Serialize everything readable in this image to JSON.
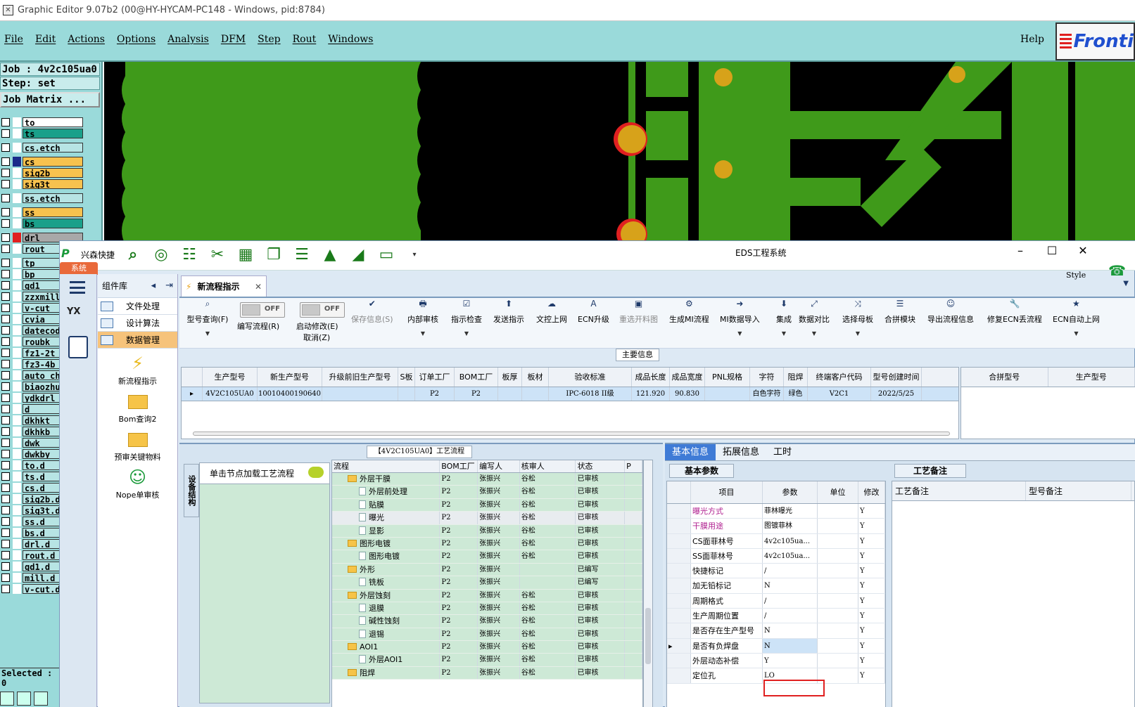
{
  "ge": {
    "title": "Graphic Editor 9.07b2 (00@HY-HYCAM-PC148 - Windows, pid:8784)",
    "menu": [
      "File",
      "Edit",
      "Actions",
      "Options",
      "Analysis",
      "DFM",
      "Step",
      "Rout",
      "Windows"
    ],
    "help": "Help",
    "logo": "Fronti",
    "job": "Job : 4v2c105ua0",
    "step": "Step: set",
    "job_matrix": "Job Matrix ...",
    "selected": "Selected : 0",
    "layers": [
      {
        "name": "to",
        "color": "#ffffff"
      },
      {
        "name": "ts",
        "color": "#1aa08a"
      },
      {
        "name": "cs.etch",
        "color": "#b7e4e4"
      },
      {
        "name": "cs",
        "color": "#f7c24e"
      },
      {
        "name": "sig2b",
        "color": "#f7c24e"
      },
      {
        "name": "sig3t",
        "color": "#f7c24e"
      },
      {
        "name": "ss.etch",
        "color": "#b7e4e4"
      },
      {
        "name": "ss",
        "color": "#f7c24e"
      },
      {
        "name": "bs",
        "color": "#1aa08a"
      },
      {
        "name": "drl",
        "color": "#a8a8a8"
      },
      {
        "name": "rout",
        "color": "#b7e4e4"
      },
      {
        "name": "tp",
        "color": "#b7e4e4"
      },
      {
        "name": "bp",
        "color": "#b7e4e4"
      },
      {
        "name": "gd1",
        "color": "#b7e4e4"
      },
      {
        "name": "zzxmill",
        "color": "#b7e4e4"
      },
      {
        "name": "v-cut",
        "color": "#b7e4e4"
      },
      {
        "name": "cvia",
        "color": "#b7e4e4"
      },
      {
        "name": "datecod",
        "color": "#b7e4e4"
      },
      {
        "name": "roubk",
        "color": "#b7e4e4"
      },
      {
        "name": "fz1-2t",
        "color": "#b7e4e4"
      },
      {
        "name": "fz3-4b",
        "color": "#b7e4e4"
      },
      {
        "name": "auto_ch",
        "color": "#b7e4e4"
      },
      {
        "name": "biaozhu",
        "color": "#b7e4e4"
      },
      {
        "name": "ydkdrl",
        "color": "#b7e4e4"
      },
      {
        "name": "d",
        "color": "#b7e4e4"
      },
      {
        "name": "dkhkt",
        "color": "#b7e4e4"
      },
      {
        "name": "dkhkb",
        "color": "#b7e4e4"
      },
      {
        "name": "dwk",
        "color": "#b7e4e4"
      },
      {
        "name": "dwkby",
        "color": "#b7e4e4"
      },
      {
        "name": "to.d",
        "color": "#b7e4e4"
      },
      {
        "name": "ts.d",
        "color": "#b7e4e4"
      },
      {
        "name": "cs.d",
        "color": "#b7e4e4"
      },
      {
        "name": "sig2b.d",
        "color": "#b7e4e4"
      },
      {
        "name": "sig3t.d",
        "color": "#b7e4e4"
      },
      {
        "name": "ss.d",
        "color": "#b7e4e4"
      },
      {
        "name": "bs.d",
        "color": "#b7e4e4"
      },
      {
        "name": "drl.d",
        "color": "#b7e4e4"
      },
      {
        "name": "rout.d",
        "color": "#b7e4e4"
      },
      {
        "name": "gd1.d",
        "color": "#b7e4e4"
      },
      {
        "name": "mill.d",
        "color": "#b7e4e4"
      },
      {
        "name": "v-cut.d",
        "color": "#b7e4e4"
      }
    ]
  },
  "eds": {
    "brand": "兴森快捷",
    "window_title": "EDS工程系统",
    "style": "Style",
    "sys_tab": "系统",
    "sidebar_header": "组件库",
    "sidebar_items": [
      "文件处理",
      "设计算法",
      "数据管理"
    ],
    "sidebar_big": [
      "新流程指示",
      "Bom查询2",
      "预审关键物料",
      "Nope单审核"
    ],
    "doc_tab": "新流程指示",
    "toolbar": {
      "query": "型号查询(F)",
      "toggle_off": "OFF",
      "edit_flow": "编写流程(R)",
      "start_modify": "启动修改(E)",
      "cancel": "取消(Z)",
      "buttons": [
        "保存信息(S)",
        "内部审核",
        "指示检查",
        "发送指示",
        "文控上网",
        "ECN升级",
        "重选开料图",
        "生成MI流程",
        "MI数据导入",
        "集成",
        "数据对比",
        "选择母板",
        "合拼模块",
        "导出流程信息",
        "修复ECN丢流程",
        "ECN自动上网"
      ]
    },
    "main_info_title": "主要信息",
    "main_grid": {
      "headers": [
        "生产型号",
        "新生产型号",
        "升级前旧生产型号",
        "S板",
        "订单工厂",
        "BOM工厂",
        "板厚",
        "板材",
        "验收标准",
        "成品长度",
        "成品宽度",
        "PNL规格",
        "字符",
        "阻焊",
        "终端客户代码",
        "型号创建时间"
      ],
      "row": [
        "4V2C105UA0",
        "10010400190640",
        "",
        "",
        "P2",
        "P2",
        "",
        "",
        "IPC-6018 II级",
        "121.920",
        "90.830",
        "",
        "白色字符",
        "绿色",
        "V2C1",
        "2022/5/25"
      ]
    },
    "side_grid_headers": [
      "合拼型号",
      "生产型号"
    ],
    "process_title": "【4V2C105UA0】工艺流程",
    "vertical_tab": "设备结构",
    "node_hint": "单击节点加载工艺流程",
    "tree_headers": [
      "流程",
      "BOM工厂",
      "编写人",
      "核审人",
      "状态",
      "P"
    ],
    "tree_rows": [
      {
        "name": "外层干膜",
        "type": "folder",
        "level": 1,
        "bom": "P2",
        "writer": "张振兴",
        "checker": "谷松",
        "status": "已审核"
      },
      {
        "name": "外层前处理",
        "type": "file",
        "level": 2,
        "bom": "P2",
        "writer": "张振兴",
        "checker": "谷松",
        "status": "已审核"
      },
      {
        "name": "贴膜",
        "type": "file",
        "level": 2,
        "bom": "P2",
        "writer": "张振兴",
        "checker": "谷松",
        "status": "已审核"
      },
      {
        "name": "曝光",
        "type": "file",
        "level": 2,
        "bom": "P2",
        "writer": "张振兴",
        "checker": "谷松",
        "status": "已审核",
        "sel": true
      },
      {
        "name": "显影",
        "type": "file",
        "level": 2,
        "bom": "P2",
        "writer": "张振兴",
        "checker": "谷松",
        "status": "已审核"
      },
      {
        "name": "图形电镀",
        "type": "folder",
        "level": 1,
        "bom": "P2",
        "writer": "张振兴",
        "checker": "谷松",
        "status": "已审核"
      },
      {
        "name": "图形电镀",
        "type": "file",
        "level": 2,
        "bom": "P2",
        "writer": "张振兴",
        "checker": "谷松",
        "status": "已审核"
      },
      {
        "name": "外形",
        "type": "folder",
        "level": 1,
        "bom": "P2",
        "writer": "张振兴",
        "checker": "",
        "status": "已编写"
      },
      {
        "name": "铣板",
        "type": "file",
        "level": 2,
        "bom": "P2",
        "writer": "张振兴",
        "checker": "",
        "status": "已编写"
      },
      {
        "name": "外层蚀刻",
        "type": "folder",
        "level": 1,
        "bom": "P2",
        "writer": "张振兴",
        "checker": "谷松",
        "status": "已审核"
      },
      {
        "name": "退膜",
        "type": "file",
        "level": 2,
        "bom": "P2",
        "writer": "张振兴",
        "checker": "谷松",
        "status": "已审核"
      },
      {
        "name": "碱性蚀刻",
        "type": "file",
        "level": 2,
        "bom": "P2",
        "writer": "张振兴",
        "checker": "谷松",
        "status": "已审核"
      },
      {
        "name": "退锡",
        "type": "file",
        "level": 2,
        "bom": "P2",
        "writer": "张振兴",
        "checker": "谷松",
        "status": "已审核"
      },
      {
        "name": "AOI1",
        "type": "folder",
        "level": 1,
        "bom": "P2",
        "writer": "张振兴",
        "checker": "谷松",
        "status": "已审核"
      },
      {
        "name": "外层AOI1",
        "type": "file",
        "level": 2,
        "bom": "P2",
        "writer": "张振兴",
        "checker": "谷松",
        "status": "已审核"
      },
      {
        "name": "阻焊",
        "type": "folder",
        "level": 1,
        "bom": "P2",
        "writer": "张振兴",
        "checker": "谷松",
        "status": "已审核"
      }
    ],
    "right_tabs": [
      "基本信息",
      "拓展信息",
      "工时"
    ],
    "basic_params_title": "基本参数",
    "process_notes_title": "工艺备注",
    "param_headers": [
      "项目",
      "参数",
      "单位",
      "修改"
    ],
    "params": [
      {
        "item": "曝光方式",
        "value": "菲林曝光",
        "unit": "",
        "mod": "Y",
        "mg": true
      },
      {
        "item": "干膜用途",
        "value": "图镀菲林",
        "unit": "",
        "mod": "Y",
        "mg": true
      },
      {
        "item": "CS面菲林号",
        "value": "4v2c105ua...",
        "unit": "",
        "mod": "Y"
      },
      {
        "item": "SS面菲林号",
        "value": "4v2c105ua...",
        "unit": "",
        "mod": "Y"
      },
      {
        "item": "快捷标记",
        "value": "/",
        "unit": "",
        "mod": "Y"
      },
      {
        "item": "加无铅标记",
        "value": "N",
        "unit": "",
        "mod": "Y"
      },
      {
        "item": "周期格式",
        "value": "/",
        "unit": "",
        "mod": "Y"
      },
      {
        "item": "生产周期位置",
        "value": "/",
        "unit": "",
        "mod": "Y"
      },
      {
        "item": "是否存在生产型号",
        "value": "N",
        "unit": "",
        "mod": "Y"
      },
      {
        "item": "是否有负焊盘",
        "value": "N",
        "unit": "",
        "mod": "Y",
        "cur": true
      },
      {
        "item": "外层动态补偿",
        "value": "Y",
        "unit": "",
        "mod": "Y"
      },
      {
        "item": "定位孔",
        "value": "LO",
        "unit": "",
        "mod": "Y"
      }
    ],
    "notes_headers": [
      "工艺备注",
      "型号备注"
    ]
  }
}
